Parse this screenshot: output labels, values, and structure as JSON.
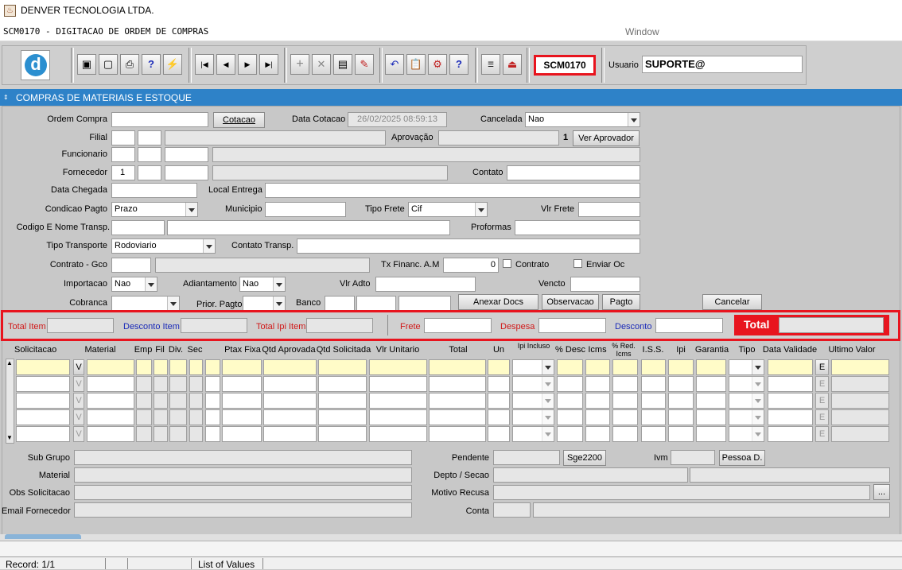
{
  "titlebar": {
    "title": "DENVER TECNOLOGIA LTDA."
  },
  "menubar": {
    "form_title": "SCM0170 - DIGITACAO DE ORDEM DE COMPRAS",
    "window_menu": "Window"
  },
  "toolbar": {
    "module_code": "SCM0170",
    "user_label": "Usuario",
    "user_value": "SUPORTE@",
    "icons": [
      "save-icon",
      "window-icon",
      "print-icon",
      "help-query-icon",
      "run-query-icon",
      "first-record-icon",
      "previous-record-icon",
      "next-record-icon",
      "last-record-icon",
      "insert-record-icon",
      "delete-record-icon",
      "print-record-icon",
      "edit-icon",
      "undo-icon",
      "clipboard-icon",
      "tools-icon",
      "help-icon",
      "menu-icon",
      "exit-icon"
    ]
  },
  "section": {
    "title": "COMPRAS DE MATERIAIS E ESTOQUE"
  },
  "form": {
    "ordem_compra_label": "Ordem Compra",
    "cotacao_button": "Cotacao",
    "data_cotacao_label": "Data Cotacao",
    "data_cotacao_value": "26/02/2025 08:59:13",
    "cancelada_label": "Cancelada",
    "cancelada_value": "Nao",
    "filial_label": "Filial",
    "aprovacao_label": "Aprovação",
    "aprovacao_num": "1",
    "ver_aprovador_button": "Ver Aprovador",
    "funcionario_label": "Funcionario",
    "fornecedor_label": "Fornecedor",
    "fornecedor_value": "1",
    "contato_label": "Contato",
    "data_chegada_label": "Data Chegada",
    "local_entrega_label": "Local Entrega",
    "condicao_pagto_label": "Condicao Pagto",
    "condicao_pagto_value": "Prazo",
    "municipio_label": "Municipio",
    "tipo_frete_label": "Tipo Frete",
    "tipo_frete_value": "Cif",
    "vlr_frete_label": "Vlr Frete",
    "codigo_transp_label": "Codigo E Nome Transp.",
    "proformas_label": "Proformas",
    "tipo_transporte_label": "Tipo Transporte",
    "tipo_transporte_value": "Rodoviario",
    "contato_transp_label": "Contato Transp.",
    "contrato_gco_label": "Contrato - Gco",
    "tx_financ_label": "Tx Financ. A.M",
    "tx_financ_value": "0",
    "contrato_chk_label": "Contrato",
    "enviar_oc_label": "Enviar Oc",
    "importacao_label": "Importacao",
    "importacao_value": "Nao",
    "adiantamento_label": "Adiantamento",
    "adiantamento_value": "Nao",
    "vlr_adto_label": "Vlr Adto",
    "vencto_label": "Vencto",
    "cobranca_label": "Cobranca",
    "prior_pagto_label": "Prior. Pagto",
    "banco_label": "Banco",
    "anexar_docs_button": "Anexar Docs",
    "observacao_button": "Observacao",
    "pagto_button": "Pagto",
    "cancelar_button": "Cancelar"
  },
  "totals": {
    "total_item": "Total Item",
    "desconto_item": "Desconto Item",
    "total_ipi_item": "Total Ipi Item",
    "frete": "Frete",
    "despesa": "Despesa",
    "desconto": "Desconto",
    "total": "Total"
  },
  "grid": {
    "headers": [
      "Solicitacao",
      "Material",
      "Emp",
      "Fil",
      "Div.",
      "Sec",
      "Ptax Fixa",
      "Qtd Aprovada",
      "Qtd  Solicitada",
      "Vlr Unitario",
      "Total",
      "Un",
      "Ipi Incluso",
      "% Desc",
      "Icms",
      "% Red. Icms",
      "I.S.S.",
      "Ipi",
      "Garantia",
      "Tipo",
      "Data Validade",
      "Ultimo Valor"
    ],
    "v_label": "V",
    "e_label": "E"
  },
  "details": {
    "sub_grupo_label": "Sub Grupo",
    "material_label": "Material",
    "obs_solicitacao_label": "Obs Solicitacao",
    "email_fornecedor_label": "Email Fornecedor",
    "pendente_label": "Pendente",
    "sge2200_button": "Sge2200",
    "ivm_label": "Ivm",
    "pessoa_d_button": "Pessoa D.",
    "depto_secao_label": "Depto / Secao",
    "motivo_recusa_label": "Motivo Recusa",
    "ellipsis_button": "...",
    "conta_label": "Conta"
  },
  "statusbar": {
    "record": "Record: 1/1",
    "list_of_values": "List of Values"
  },
  "colors": {
    "section_bar": "#2e82c8",
    "highlight_red": "#e8141e",
    "field_yellow": "#fffcc8"
  }
}
